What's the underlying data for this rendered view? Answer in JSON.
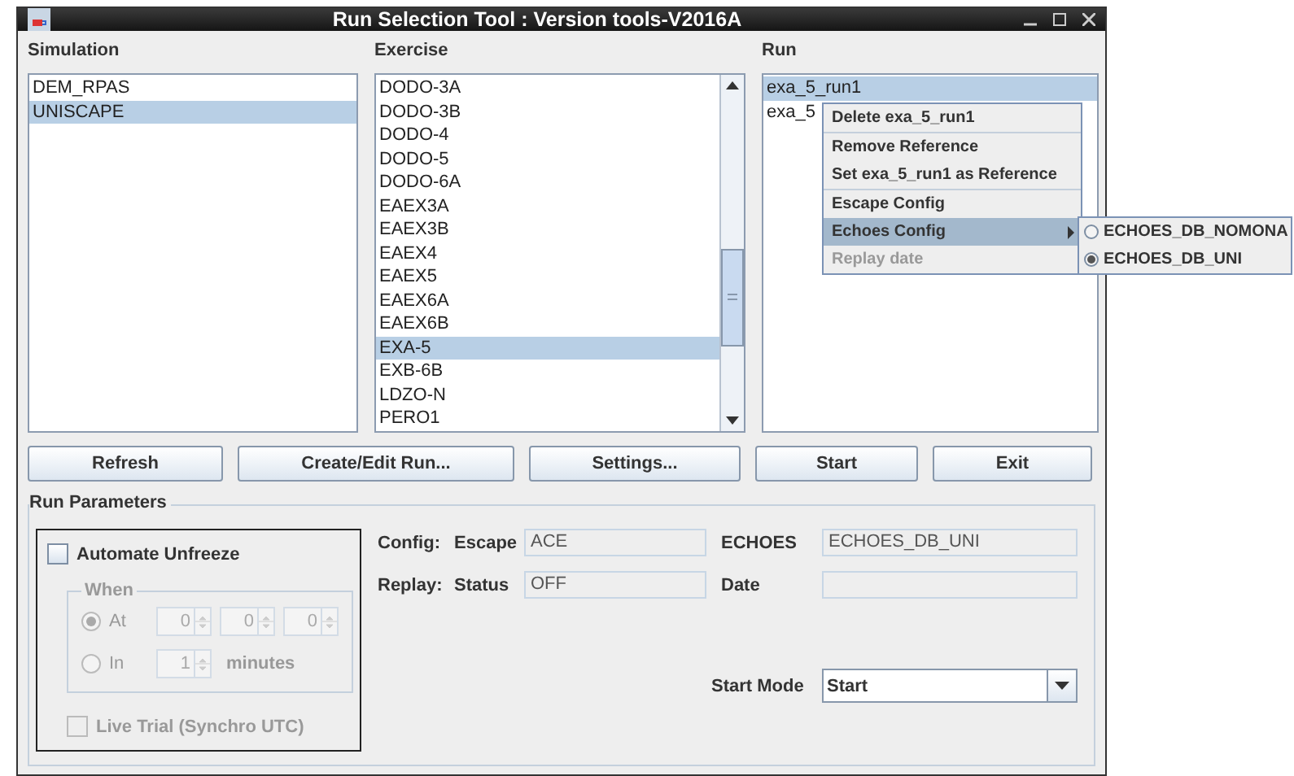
{
  "window": {
    "title": "Run Selection Tool : Version tools-V2016A"
  },
  "lists": [
    {
      "label": "Simulation",
      "scroll": false,
      "items": [
        {
          "label": "DEM_RPAS",
          "selected": false
        },
        {
          "label": "UNISCAPE",
          "selected": true
        }
      ]
    },
    {
      "label": "Exercise",
      "scroll": true,
      "items": [
        {
          "label": "DODO-3A",
          "selected": false
        },
        {
          "label": "DODO-3B",
          "selected": false
        },
        {
          "label": "DODO-4",
          "selected": false
        },
        {
          "label": "DODO-5",
          "selected": false
        },
        {
          "label": "DODO-6A",
          "selected": false
        },
        {
          "label": "EAEX3A",
          "selected": false
        },
        {
          "label": "EAEX3B",
          "selected": false
        },
        {
          "label": "EAEX4",
          "selected": false
        },
        {
          "label": "EAEX5",
          "selected": false
        },
        {
          "label": "EAEX6A",
          "selected": false
        },
        {
          "label": "EAEX6B",
          "selected": false
        },
        {
          "label": "EXA-5",
          "selected": true
        },
        {
          "label": "EXB-6B",
          "selected": false
        },
        {
          "label": "LDZO-N",
          "selected": false
        },
        {
          "label": "PERO1",
          "selected": false
        }
      ]
    },
    {
      "label": "Run",
      "scroll": false,
      "items": [
        {
          "label": "exa_5_run1",
          "selected": true
        },
        {
          "label": "exa_5",
          "selected": false
        }
      ]
    }
  ],
  "context_menu": {
    "groups": [
      [
        {
          "label": "Delete exa_5_run1",
          "highlighted": false,
          "disabled": false
        }
      ],
      [
        {
          "label": "Remove Reference",
          "highlighted": false,
          "disabled": false
        },
        {
          "label": "Set exa_5_run1 as  Reference",
          "highlighted": false,
          "disabled": false
        }
      ],
      [
        {
          "label": "Escape Config",
          "highlighted": false,
          "disabled": false
        },
        {
          "label": "Echoes Config",
          "highlighted": true,
          "disabled": false,
          "submenu": [
            {
              "label": "ECHOES_DB_NOMONA",
              "selected": false
            },
            {
              "label": "ECHOES_DB_UNI",
              "selected": true
            }
          ]
        },
        {
          "label": "Replay date",
          "highlighted": false,
          "disabled": true
        }
      ]
    ]
  },
  "buttons": [
    "Refresh",
    "Create/Edit Run...",
    "Settings...",
    "Start",
    "Exit"
  ],
  "run_parameters": {
    "title": "Run Parameters",
    "automate_unfreeze": {
      "label": "Automate Unfreeze",
      "checked": false
    },
    "when": {
      "label": "When",
      "disabled": true,
      "at": {
        "label": "At",
        "selected": true,
        "values": [
          "0",
          "0",
          "0"
        ]
      },
      "in": {
        "label": "In",
        "selected": false,
        "value": "1",
        "unit": "minutes"
      }
    },
    "live_trial": {
      "label": "Live Trial (Synchro UTC)",
      "checked": false,
      "disabled": true
    },
    "rows": [
      {
        "label": "Config:",
        "sublabel": "Escape",
        "value": "ACE",
        "label2": "ECHOES",
        "value2": "ECHOES_DB_UNI"
      },
      {
        "label": "Replay:",
        "sublabel": "Status",
        "value": "OFF",
        "label2": "Date",
        "value2": ""
      }
    ],
    "start_mode": {
      "label": "Start Mode",
      "value": "Start"
    }
  }
}
